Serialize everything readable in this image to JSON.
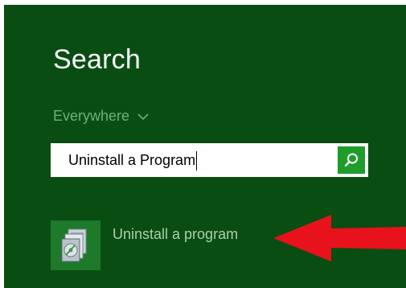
{
  "search_panel": {
    "title": "Search",
    "scope_label": "Everywhere",
    "query": "Uninstall a Program",
    "search_button_icon": "search-icon"
  },
  "results": [
    {
      "label": "Uninstall a program",
      "icon": "programs-and-features-icon"
    }
  ],
  "annotation": {
    "arrow_icon": "red-arrow-icon",
    "arrow_color": "#e8121c"
  },
  "colors": {
    "panel_background": "#0a4d12",
    "accent_green": "#1f9d2b",
    "scope_text": "#6fae7b",
    "result_text": "#a9cfb0"
  }
}
